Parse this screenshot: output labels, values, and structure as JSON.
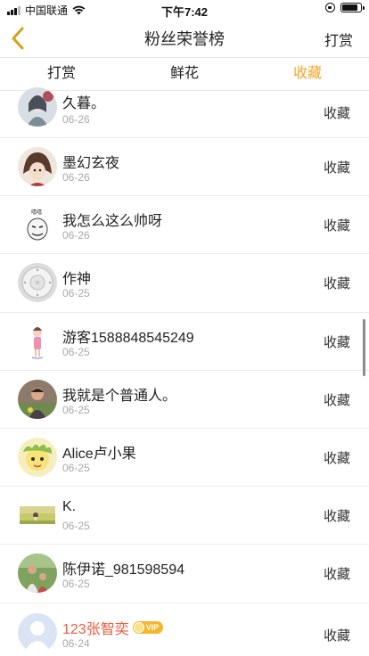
{
  "status_bar": {
    "carrier": "中国联通",
    "time": "下午7:42",
    "icons": [
      "signal-icon",
      "wifi-icon",
      "orientation-lock-icon",
      "battery-icon"
    ]
  },
  "header": {
    "title": "粉丝荣誉榜",
    "back_icon": "chevron-left-icon",
    "action_label": "打赏",
    "accent_color": "#f5a623"
  },
  "tabs": [
    {
      "label": "打赏",
      "active": false
    },
    {
      "label": "鲜花",
      "active": false
    },
    {
      "label": "收藏",
      "active": true
    }
  ],
  "list": {
    "items": [
      {
        "name": "久暮。",
        "date": "06-26",
        "action": "收藏",
        "avatar": "anime-girl-avatar"
      },
      {
        "name": "墨幻玄夜",
        "date": "06-26",
        "action": "收藏",
        "avatar": "anime-character-avatar"
      },
      {
        "name": "我怎么这么帅呀",
        "date": "06-26",
        "action": "收藏",
        "avatar": "meme-face-avatar"
      },
      {
        "name": "作神",
        "date": "06-25",
        "action": "收藏",
        "avatar": "smoke-detector-avatar"
      },
      {
        "name": "游客1588848545249",
        "date": "06-25",
        "action": "收藏",
        "avatar": "small-figure-avatar"
      },
      {
        "name": "我就是个普通人。",
        "date": "06-25",
        "action": "收藏",
        "avatar": "photo-avatar"
      },
      {
        "name": "Alice卢小果",
        "date": "06-25",
        "action": "收藏",
        "avatar": "cartoon-avatar"
      },
      {
        "name": "K.",
        "date": "06-25",
        "action": "收藏",
        "avatar": "landscape-avatar"
      },
      {
        "name": "陈伊诺_981598594",
        "date": "06-25",
        "action": "收藏",
        "avatar": "outdoor-photo-avatar"
      },
      {
        "name": "123张智奕",
        "date": "06-24",
        "action": "收藏",
        "avatar": "default-user-avatar",
        "vip": true,
        "vip_label": "VIP"
      }
    ]
  }
}
